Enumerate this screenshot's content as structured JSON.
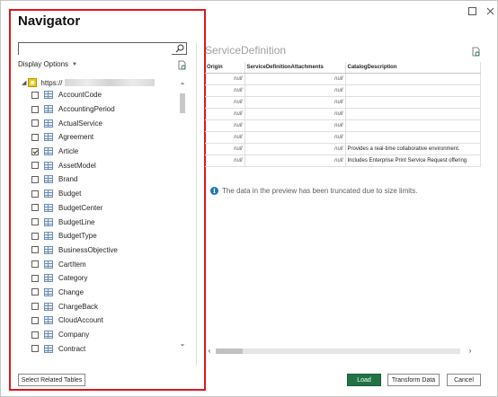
{
  "window": {
    "maximize_icon": "maximize-icon",
    "close_icon": "close-icon"
  },
  "navigator": {
    "title": "Navigator",
    "search": {
      "value": "",
      "placeholder": ""
    },
    "display_options_label": "Display Options",
    "root_label": "https://",
    "items": [
      {
        "label": "AccountCode",
        "checked": false
      },
      {
        "label": "AccountingPeriod",
        "checked": false
      },
      {
        "label": "ActualService",
        "checked": false
      },
      {
        "label": "Agreement",
        "checked": false
      },
      {
        "label": "Article",
        "checked": true
      },
      {
        "label": "AssetModel",
        "checked": false
      },
      {
        "label": "Brand",
        "checked": false
      },
      {
        "label": "Budget",
        "checked": false
      },
      {
        "label": "BudgetCenter",
        "checked": false
      },
      {
        "label": "BudgetLine",
        "checked": false
      },
      {
        "label": "BudgetType",
        "checked": false
      },
      {
        "label": "BusinessObjective",
        "checked": false
      },
      {
        "label": "CartItem",
        "checked": false
      },
      {
        "label": "Category",
        "checked": false
      },
      {
        "label": "Change",
        "checked": false
      },
      {
        "label": "ChargeBack",
        "checked": false
      },
      {
        "label": "CloudAccount",
        "checked": false
      },
      {
        "label": "Company",
        "checked": false
      },
      {
        "label": "Contract",
        "checked": false
      }
    ],
    "select_related_label": "Select Related Tables"
  },
  "preview": {
    "title": "ServiceDefinition",
    "columns": [
      "Origin",
      "ServiceDefinitionAttachments",
      "CatalogDescription"
    ],
    "rows": [
      [
        "null",
        "null",
        ""
      ],
      [
        "null",
        "null",
        ""
      ],
      [
        "null",
        "null",
        ""
      ],
      [
        "null",
        "null",
        ""
      ],
      [
        "null",
        "null",
        ""
      ],
      [
        "null",
        "null",
        ""
      ],
      [
        "null",
        "null",
        "Provides a real-time collaborative environment."
      ],
      [
        "null",
        "null",
        "Includes Enterprise Print Service Request offering"
      ]
    ],
    "info_text": "The data in the preview has been truncated due to size limits."
  },
  "footer": {
    "load_label": "Load",
    "transform_label": "Transform Data",
    "cancel_label": "Cancel"
  },
  "colors": {
    "highlight_border": "#e0161c",
    "load_button": "#217346",
    "info_icon": "#1f74b5"
  }
}
